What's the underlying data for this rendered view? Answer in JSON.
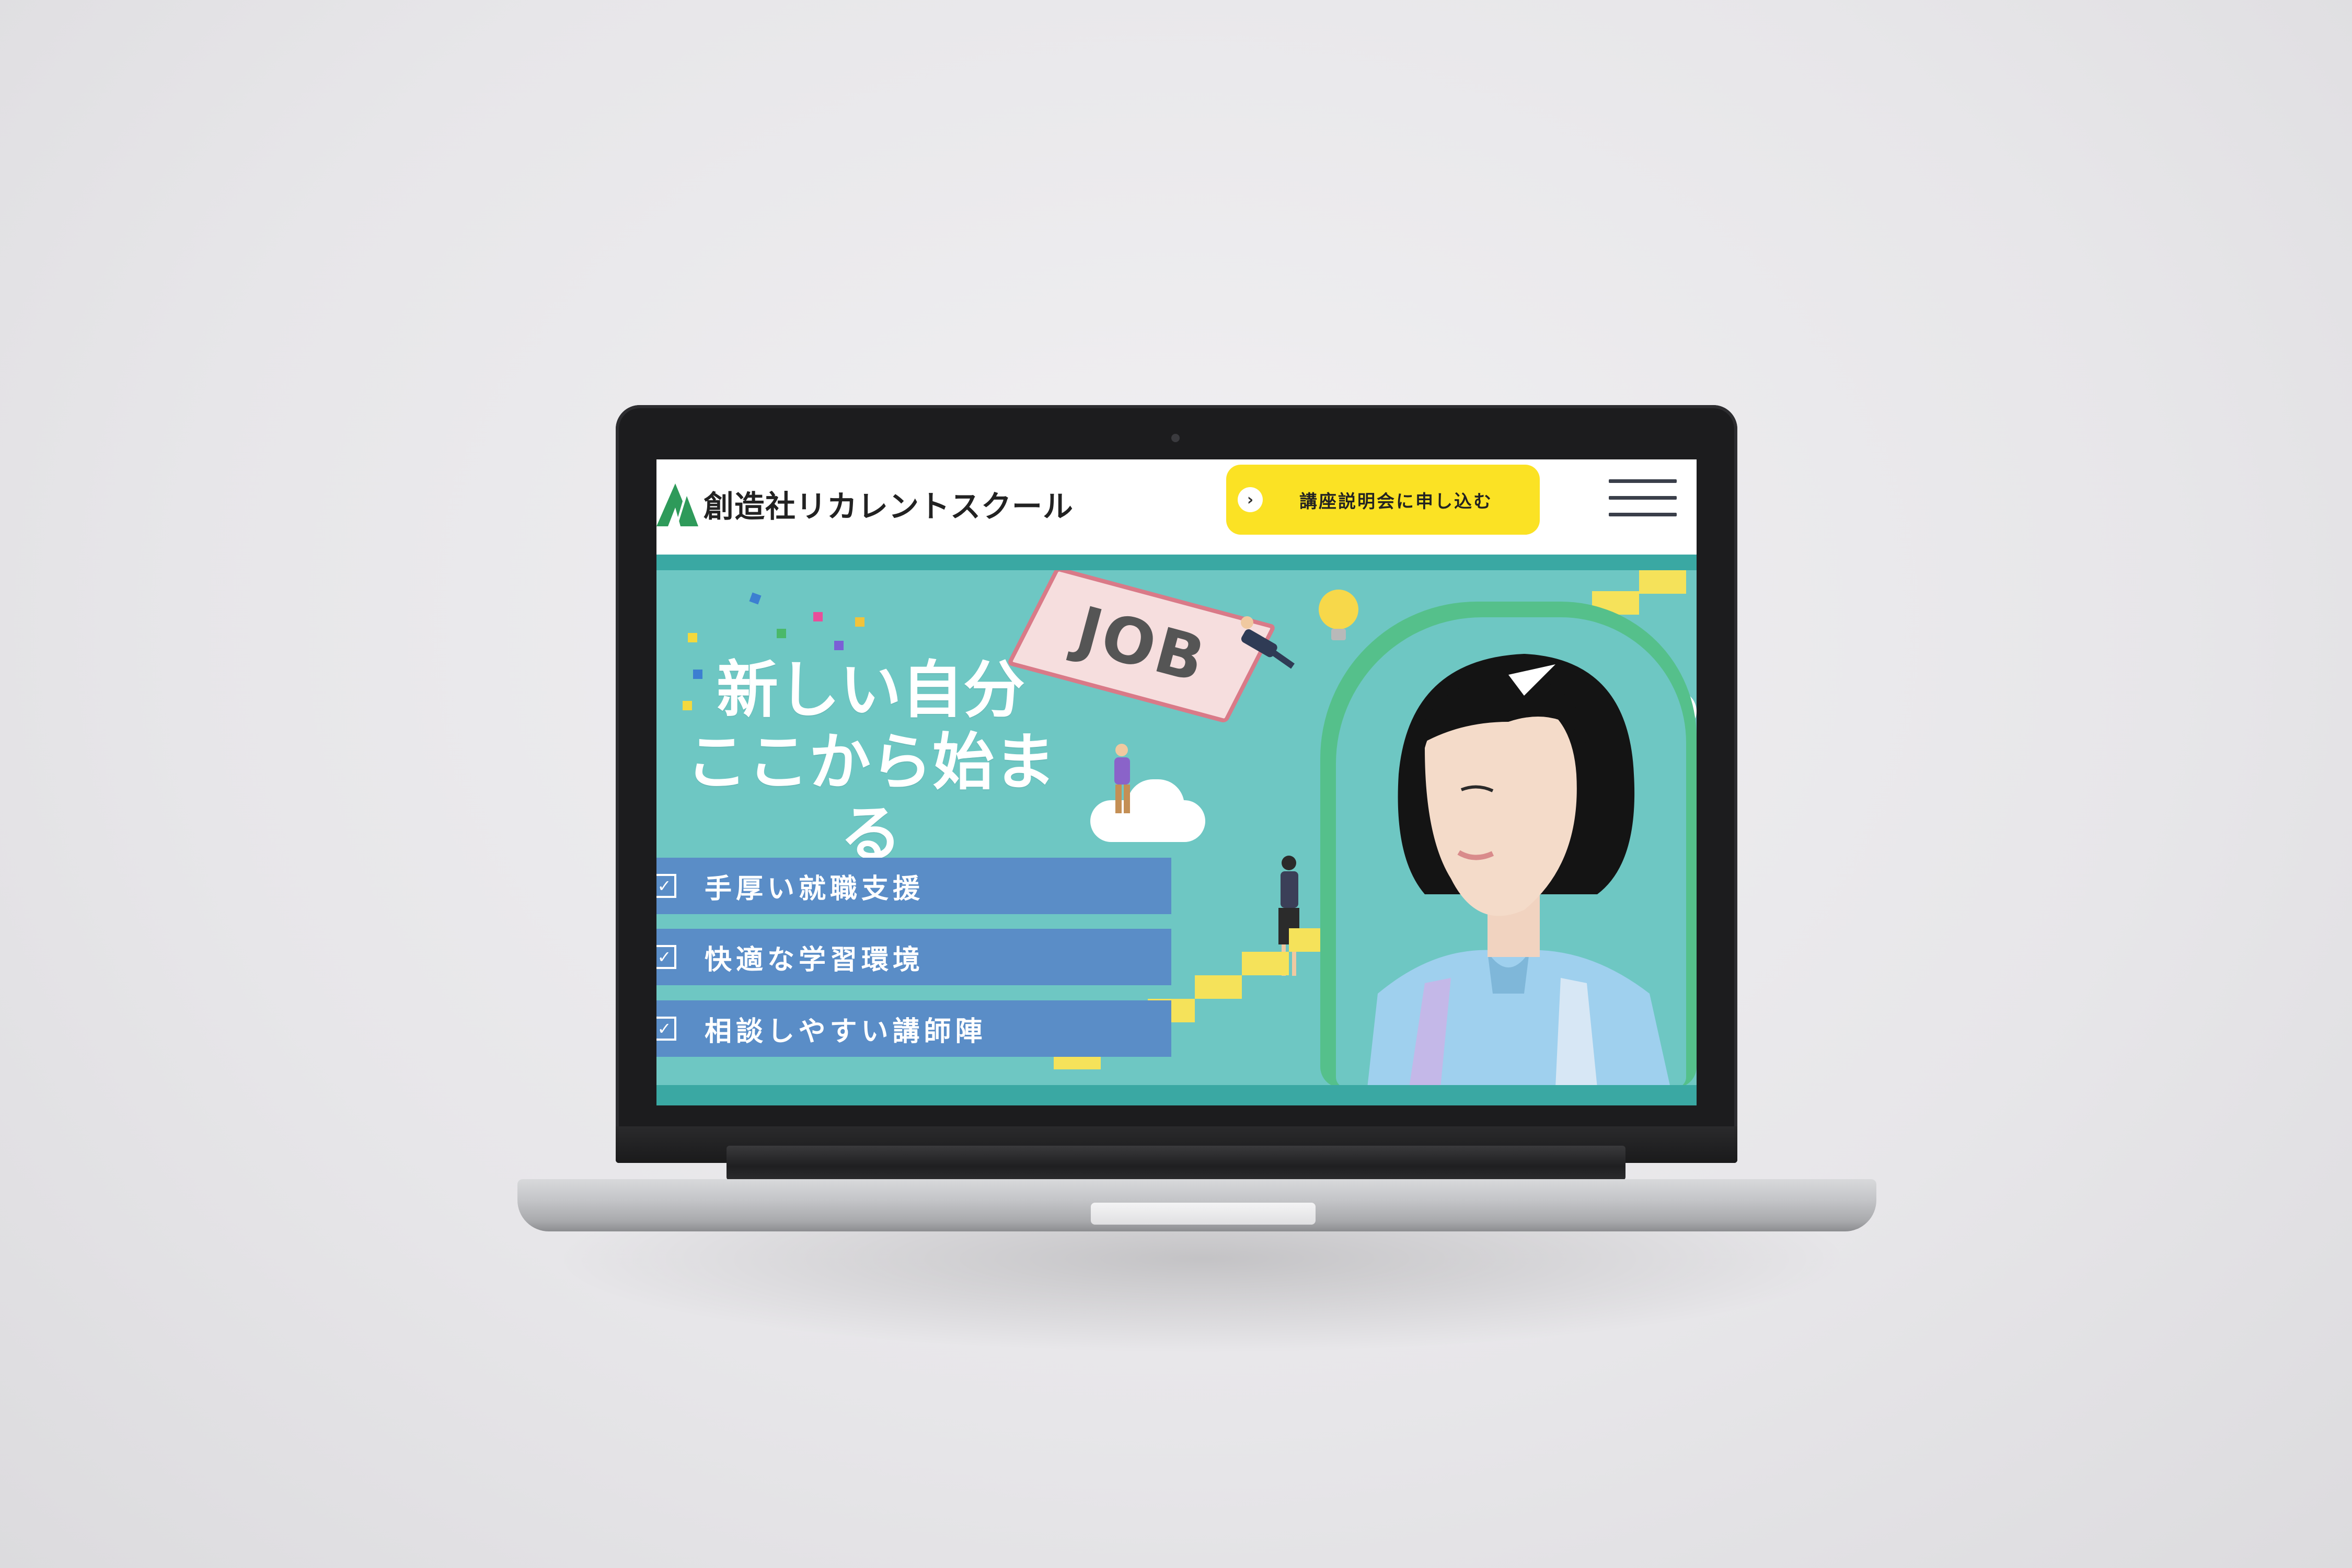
{
  "site": {
    "logo_text": "創造社リカレントスクール",
    "cta_label": "講座説明会に申し込む",
    "hero": {
      "headline_line1": "新しい自分",
      "headline_line2": "ここから始まる",
      "sign_text": "JOB",
      "features": [
        {
          "label": "手厚い就職支援"
        },
        {
          "label": "快適な学習環境"
        },
        {
          "label": "相談しやすい講師陣"
        }
      ]
    }
  },
  "colors": {
    "brand_teal": "#3aa8a3",
    "hero_bg": "#6ec7c3",
    "cta_yellow": "#fbe224",
    "feature_blue": "#5a8dc7",
    "logo_green": "#2e9a5a"
  }
}
